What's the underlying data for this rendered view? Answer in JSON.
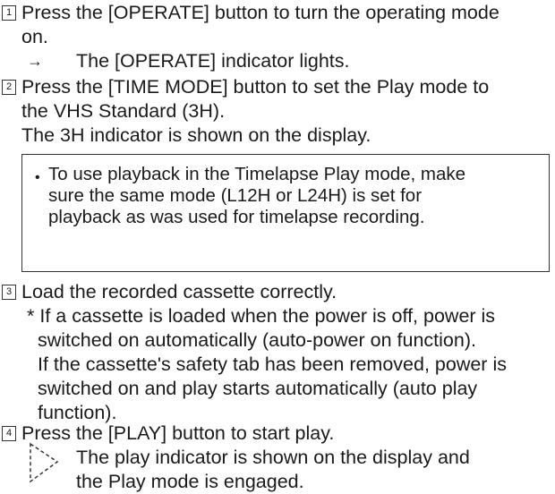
{
  "steps": [
    {
      "number": "1",
      "lines": [
        "Press the [OPERATE] button to turn the operating mode",
        "on."
      ],
      "result": "The [OPERATE] indicator lights."
    },
    {
      "number": "2",
      "lines": [
        "Press the [TIME MODE] button to set the Play mode to",
        "the VHS Standard (3H).",
        "The 3H indicator is shown on the display."
      ]
    },
    {
      "number": "3",
      "lines": [
        "Load the recorded cassette correctly."
      ],
      "note_lines": [
        "* If a cassette is loaded when the power is off, power is",
        "switched on automatically (auto-power on function).",
        "If the cassette's safety tab has been removed, power is",
        "switched on and play starts automatically (auto play",
        "function)."
      ]
    },
    {
      "number": "4",
      "lines": [
        "Press the [PLAY] button to start play."
      ],
      "result_lines": [
        "The play indicator is shown on the display and",
        "the Play mode is engaged."
      ]
    }
  ],
  "notebox": {
    "bullet": "•",
    "lines": [
      "To use playback in the Timelapse Play mode, make",
      "sure the same mode (L12H or L24H) is set for",
      "playback as was used for timelapse recording."
    ]
  },
  "icons": {
    "arrow": "→"
  }
}
